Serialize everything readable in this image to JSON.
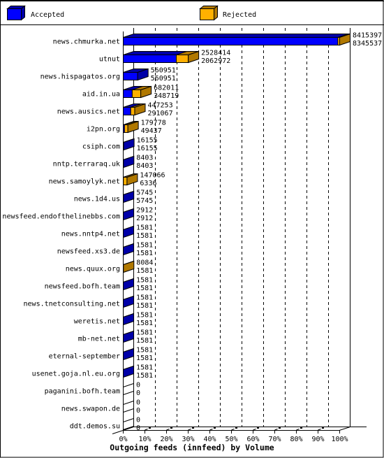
{
  "chart_data": {
    "type": "bar",
    "orientation": "horizontal",
    "stacked": true,
    "style": "3d",
    "title": "",
    "xlabel": "Outgoing feeds (innfeed) by Volume",
    "ylabel": "",
    "xlim": [
      0,
      100
    ],
    "x_axis_unit": "percent of largest total volume",
    "xticks": [
      "0%",
      "10%",
      "20%",
      "30%",
      "40%",
      "50%",
      "60%",
      "70%",
      "80%",
      "90%",
      "100%"
    ],
    "grid": true,
    "legend": "top",
    "categories": [
      "news.chmurka.net",
      "utnut",
      "news.hispagatos.org",
      "aid.in.ua",
      "news.ausics.net",
      "i2pn.org",
      "csiph.com",
      "nntp.terraraq.uk",
      "news.samoylyk.net",
      "news.1d4.us",
      "newsfeed.endofthelinebbs.com",
      "news.nntp4.net",
      "newsfeed.xs3.de",
      "news.quux.org",
      "newsfeed.bofh.team",
      "news.tnetconsulting.net",
      "weretis.net",
      "mb-net.net",
      "eternal-september",
      "usenet.goja.nl.eu.org",
      "paganini.bofh.team",
      "news.swapon.de",
      "ddt.demos.su"
    ],
    "totals": [
      8415397,
      2528414,
      560951,
      682011,
      447253,
      179778,
      16155,
      8403,
      147066,
      5745,
      2912,
      1581,
      1581,
      8084,
      1581,
      1581,
      1581,
      1581,
      1581,
      1581,
      0,
      0,
      0
    ],
    "series": [
      {
        "name": "Accepted",
        "color": "#0000FF",
        "shade": "#0000A8",
        "values": [
          8345537,
          2062972,
          560951,
          348719,
          291067,
          49437,
          16155,
          8403,
          6336,
          5745,
          2912,
          1581,
          1581,
          1581,
          1581,
          1581,
          1581,
          1581,
          1581,
          1581,
          0,
          0,
          0
        ]
      },
      {
        "name": "Rejected",
        "color": "#FFB000",
        "shade": "#B07800",
        "values": [
          69860,
          465442,
          0,
          333292,
          156186,
          130341,
          0,
          0,
          140730,
          0,
          0,
          0,
          0,
          6503,
          0,
          0,
          0,
          0,
          0,
          0,
          0,
          0,
          0
        ]
      }
    ]
  }
}
